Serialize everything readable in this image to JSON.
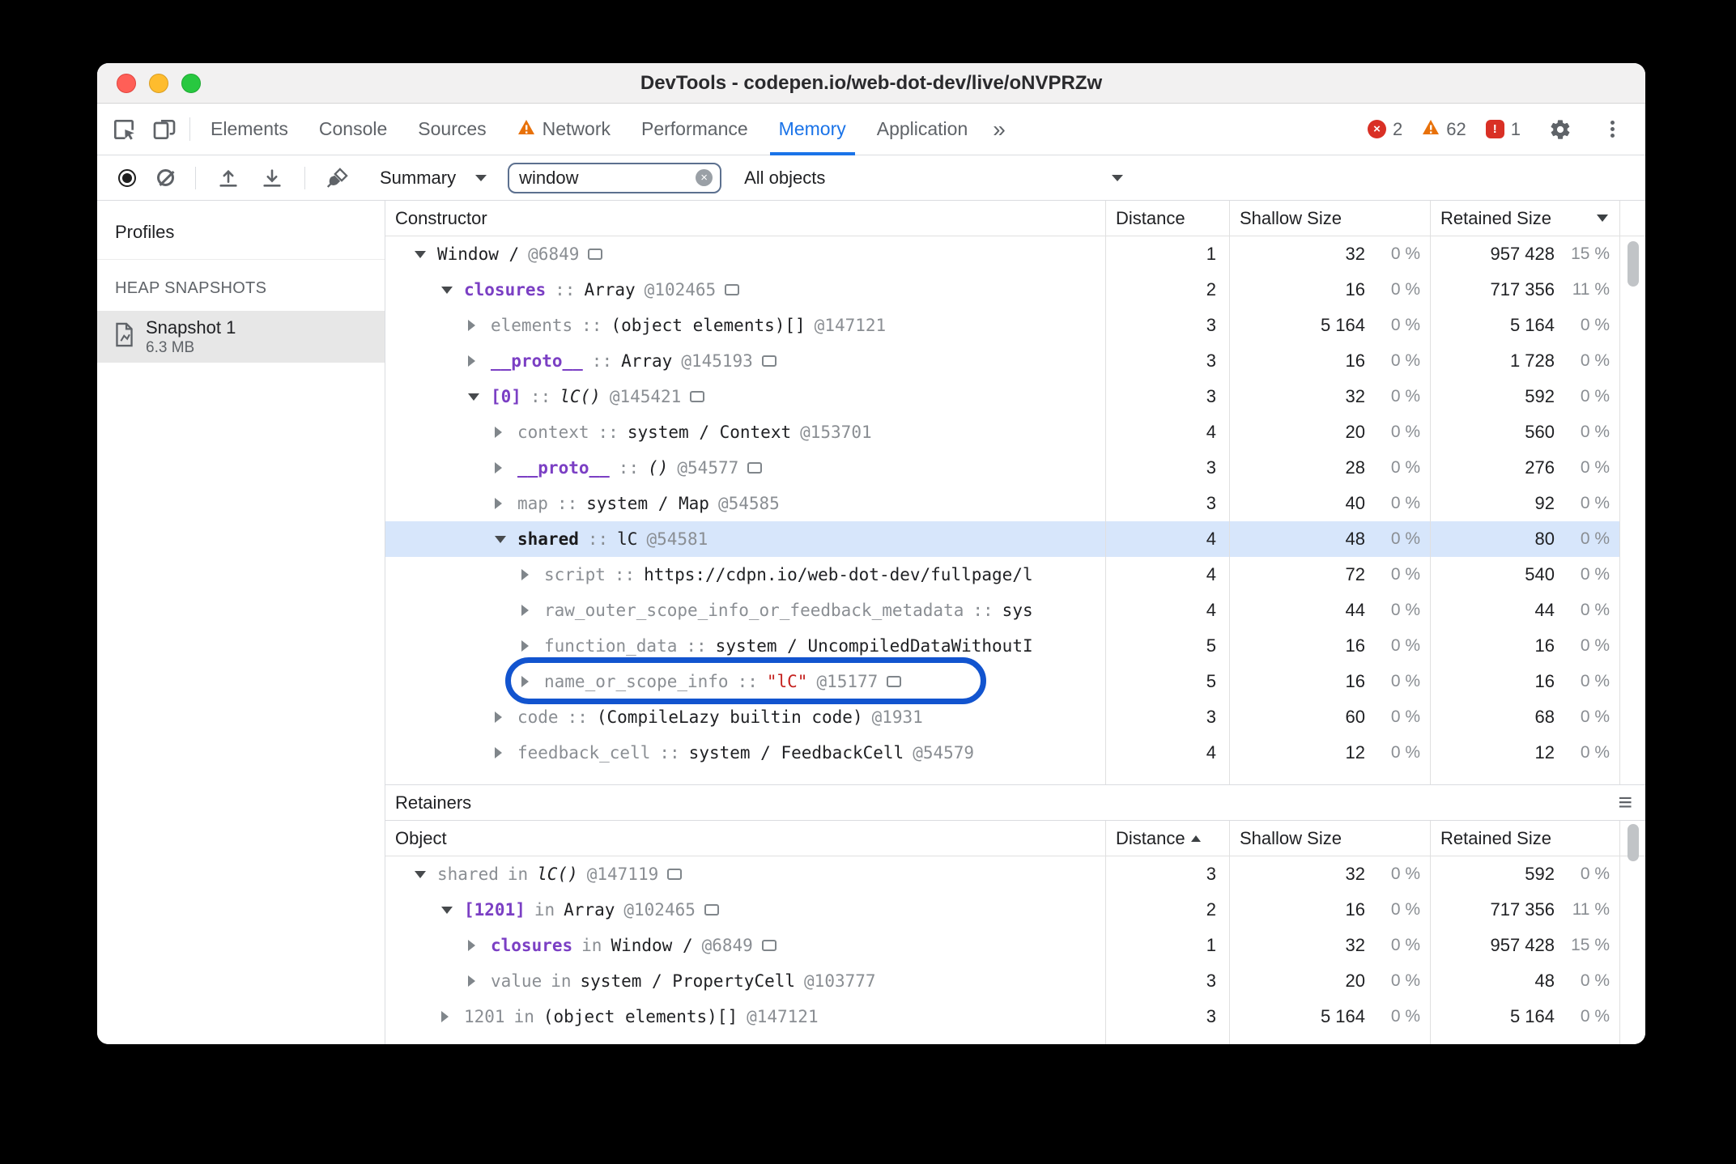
{
  "colors": {
    "accent_blue": "#1a73e8",
    "annotation_blue": "#1254cf",
    "selected_row_blue": "#d7e6fb",
    "error_red": "#d93025",
    "warning_orange": "#e8710a",
    "string_red": "#c5221f",
    "retaining_path_purple": "#7b3fc4"
  },
  "icons": {
    "error": "×",
    "issue": "!",
    "clear_search": "×",
    "hamburger": "≡"
  },
  "titlebar": {
    "title": "DevTools - codepen.io/web-dot-dev/live/oNVPRZw"
  },
  "tabbar": {
    "tabs": [
      {
        "label": "Elements"
      },
      {
        "label": "Console"
      },
      {
        "label": "Sources"
      },
      {
        "label": "Network",
        "warning": true
      },
      {
        "label": "Performance"
      },
      {
        "label": "Memory",
        "selected": true
      },
      {
        "label": "Application"
      }
    ],
    "more": "»",
    "error_count": "2",
    "warning_count": "62",
    "issue_count": "1"
  },
  "toolbar": {
    "profile_select": "Summary",
    "filter": {
      "value": "window"
    },
    "object_select": "All objects"
  },
  "sidebar": {
    "header": "Profiles",
    "section": "HEAP SNAPSHOTS",
    "snapshot_name": "Snapshot 1",
    "snapshot_size": "6.3 MB"
  },
  "constructor_table": {
    "col_constructor": "Constructor",
    "col_distance": "Distance",
    "col_shallow": "Shallow Size",
    "col_retained": "Retained Size",
    "sort_column": "Retained Size",
    "sort_dir": "desc",
    "rows": [
      {
        "indent": 0,
        "exp": "open",
        "segs": [
          {
            "t": "Window /",
            "s": "obj"
          },
          {
            "t": "@6849",
            "s": "id"
          }
        ],
        "icon": true,
        "d": "1",
        "sh": "32",
        "shp": "0 %",
        "rt": "957 428",
        "rtp": "15 %"
      },
      {
        "indent": 1,
        "exp": "open",
        "segs": [
          {
            "t": "closures",
            "s": "pathprop"
          },
          {
            "t": "::",
            "s": "sep"
          },
          {
            "t": "Array",
            "s": "obj"
          },
          {
            "t": "@102465",
            "s": "id"
          }
        ],
        "icon": true,
        "d": "2",
        "sh": "16",
        "shp": "0 %",
        "rt": "717 356",
        "rtp": "11 %"
      },
      {
        "indent": 2,
        "exp": "closed",
        "segs": [
          {
            "t": "elements",
            "s": "prop"
          },
          {
            "t": "::",
            "s": "sep"
          },
          {
            "t": "(object elements)[]",
            "s": "obj"
          },
          {
            "t": "@147121",
            "s": "id"
          }
        ],
        "d": "3",
        "sh": "5 164",
        "shp": "0 %",
        "rt": "5 164",
        "rtp": "0 %"
      },
      {
        "indent": 2,
        "exp": "closed",
        "segs": [
          {
            "t": "__proto__",
            "s": "pathprop"
          },
          {
            "t": "::",
            "s": "sep"
          },
          {
            "t": "Array",
            "s": "obj"
          },
          {
            "t": "@145193",
            "s": "id"
          }
        ],
        "icon": true,
        "d": "3",
        "sh": "16",
        "shp": "0 %",
        "rt": "1 728",
        "rtp": "0 %"
      },
      {
        "indent": 2,
        "exp": "open",
        "segs": [
          {
            "t": "[0]",
            "s": "pathprop"
          },
          {
            "t": "::",
            "s": "sep"
          },
          {
            "t": "lC()",
            "s": "fn"
          },
          {
            "t": "@145421",
            "s": "id"
          }
        ],
        "icon": true,
        "d": "3",
        "sh": "32",
        "shp": "0 %",
        "rt": "592",
        "rtp": "0 %"
      },
      {
        "indent": 3,
        "exp": "closed",
        "segs": [
          {
            "t": "context",
            "s": "prop"
          },
          {
            "t": "::",
            "s": "sep"
          },
          {
            "t": "system / Context",
            "s": "obj"
          },
          {
            "t": "@153701",
            "s": "id"
          }
        ],
        "d": "4",
        "sh": "20",
        "shp": "0 %",
        "rt": "560",
        "rtp": "0 %"
      },
      {
        "indent": 3,
        "exp": "closed",
        "segs": [
          {
            "t": "__proto__",
            "s": "pathprop"
          },
          {
            "t": "::",
            "s": "sep"
          },
          {
            "t": "()",
            "s": "fn"
          },
          {
            "t": "@54577",
            "s": "id"
          }
        ],
        "icon": true,
        "d": "3",
        "sh": "28",
        "shp": "0 %",
        "rt": "276",
        "rtp": "0 %"
      },
      {
        "indent": 3,
        "exp": "closed",
        "segs": [
          {
            "t": "map",
            "s": "prop"
          },
          {
            "t": "::",
            "s": "sep"
          },
          {
            "t": "system / Map",
            "s": "obj"
          },
          {
            "t": "@54585",
            "s": "id"
          }
        ],
        "d": "3",
        "sh": "40",
        "shp": "0 %",
        "rt": "92",
        "rtp": "0 %"
      },
      {
        "indent": 3,
        "exp": "open",
        "selected": true,
        "segs": [
          {
            "t": "shared",
            "s": "selprop"
          },
          {
            "t": "::",
            "s": "sep"
          },
          {
            "t": "lC",
            "s": "obj"
          },
          {
            "t": "@54581",
            "s": "id"
          }
        ],
        "d": "4",
        "sh": "48",
        "shp": "0 %",
        "rt": "80",
        "rtp": "0 %"
      },
      {
        "indent": 4,
        "exp": "closed",
        "segs": [
          {
            "t": "script",
            "s": "prop"
          },
          {
            "t": "::",
            "s": "sep"
          },
          {
            "t": "https://cdpn.io/web-dot-dev/fullpage/l",
            "s": "obj"
          }
        ],
        "d": "4",
        "sh": "72",
        "shp": "0 %",
        "rt": "540",
        "rtp": "0 %"
      },
      {
        "indent": 4,
        "exp": "closed",
        "segs": [
          {
            "t": "raw_outer_scope_info_or_feedback_metadata",
            "s": "prop"
          },
          {
            "t": "::",
            "s": "sep"
          },
          {
            "t": "sys",
            "s": "obj"
          }
        ],
        "d": "4",
        "sh": "44",
        "shp": "0 %",
        "rt": "44",
        "rtp": "0 %"
      },
      {
        "indent": 4,
        "exp": "closed",
        "segs": [
          {
            "t": "function_data",
            "s": "prop"
          },
          {
            "t": "::",
            "s": "sep"
          },
          {
            "t": "system / UncompiledDataWithoutI",
            "s": "obj"
          }
        ],
        "d": "5",
        "sh": "16",
        "shp": "0 %",
        "rt": "16",
        "rtp": "0 %"
      },
      {
        "indent": 4,
        "exp": "closed",
        "annotated": true,
        "segs": [
          {
            "t": "name_or_scope_info",
            "s": "prop"
          },
          {
            "t": "::",
            "s": "sep"
          },
          {
            "t": "\"lC\"",
            "s": "str"
          },
          {
            "t": "@15177",
            "s": "id"
          }
        ],
        "icon": true,
        "d": "5",
        "sh": "16",
        "shp": "0 %",
        "rt": "16",
        "rtp": "0 %"
      },
      {
        "indent": 3,
        "exp": "closed",
        "segs": [
          {
            "t": "code",
            "s": "prop"
          },
          {
            "t": "::",
            "s": "sep"
          },
          {
            "t": "(CompileLazy builtin code)",
            "s": "obj"
          },
          {
            "t": "@1931",
            "s": "id"
          }
        ],
        "d": "3",
        "sh": "60",
        "shp": "0 %",
        "rt": "68",
        "rtp": "0 %"
      },
      {
        "indent": 3,
        "exp": "closed",
        "segs": [
          {
            "t": "feedback_cell",
            "s": "prop"
          },
          {
            "t": "::",
            "s": "sep"
          },
          {
            "t": "system / FeedbackCell",
            "s": "obj"
          },
          {
            "t": "@54579",
            "s": "id"
          }
        ],
        "d": "4",
        "sh": "12",
        "shp": "0 %",
        "rt": "12",
        "rtp": "0 %"
      }
    ]
  },
  "retainers": {
    "title": "Retainers",
    "col_object": "Object",
    "col_distance": "Distance",
    "col_shallow": "Shallow Size",
    "col_retained": "Retained Size",
    "sort_column": "Distance",
    "sort_dir": "asc",
    "rows": [
      {
        "indent": 0,
        "exp": "open",
        "segs": [
          {
            "t": "shared",
            "s": "prop"
          },
          {
            "t": "in",
            "s": "sep"
          },
          {
            "t": "lC()",
            "s": "fn"
          },
          {
            "t": "@147119",
            "s": "id"
          }
        ],
        "icon": true,
        "d": "3",
        "sh": "32",
        "shp": "0 %",
        "rt": "592",
        "rtp": "0 %"
      },
      {
        "indent": 1,
        "exp": "open",
        "segs": [
          {
            "t": "[1201]",
            "s": "pathprop"
          },
          {
            "t": "in",
            "s": "sep"
          },
          {
            "t": "Array",
            "s": "obj"
          },
          {
            "t": "@102465",
            "s": "id"
          }
        ],
        "icon": true,
        "d": "2",
        "sh": "16",
        "shp": "0 %",
        "rt": "717 356",
        "rtp": "11 %"
      },
      {
        "indent": 2,
        "exp": "closed",
        "segs": [
          {
            "t": "closures",
            "s": "pathprop"
          },
          {
            "t": "in",
            "s": "sep"
          },
          {
            "t": "Window /",
            "s": "obj"
          },
          {
            "t": "@6849",
            "s": "id"
          }
        ],
        "icon": true,
        "d": "1",
        "sh": "32",
        "shp": "0 %",
        "rt": "957 428",
        "rtp": "15 %"
      },
      {
        "indent": 2,
        "exp": "closed",
        "segs": [
          {
            "t": "value",
            "s": "prop"
          },
          {
            "t": "in",
            "s": "sep"
          },
          {
            "t": "system / PropertyCell",
            "s": "obj"
          },
          {
            "t": "@103777",
            "s": "id"
          }
        ],
        "d": "3",
        "sh": "20",
        "shp": "0 %",
        "rt": "48",
        "rtp": "0 %"
      },
      {
        "indent": 1,
        "exp": "closed",
        "segs": [
          {
            "t": "1201",
            "s": "prop"
          },
          {
            "t": "in",
            "s": "sep"
          },
          {
            "t": "(object elements)[]",
            "s": "obj"
          },
          {
            "t": "@147121",
            "s": "id"
          }
        ],
        "d": "3",
        "sh": "5 164",
        "shp": "0 %",
        "rt": "5 164",
        "rtp": "0 %"
      }
    ]
  }
}
